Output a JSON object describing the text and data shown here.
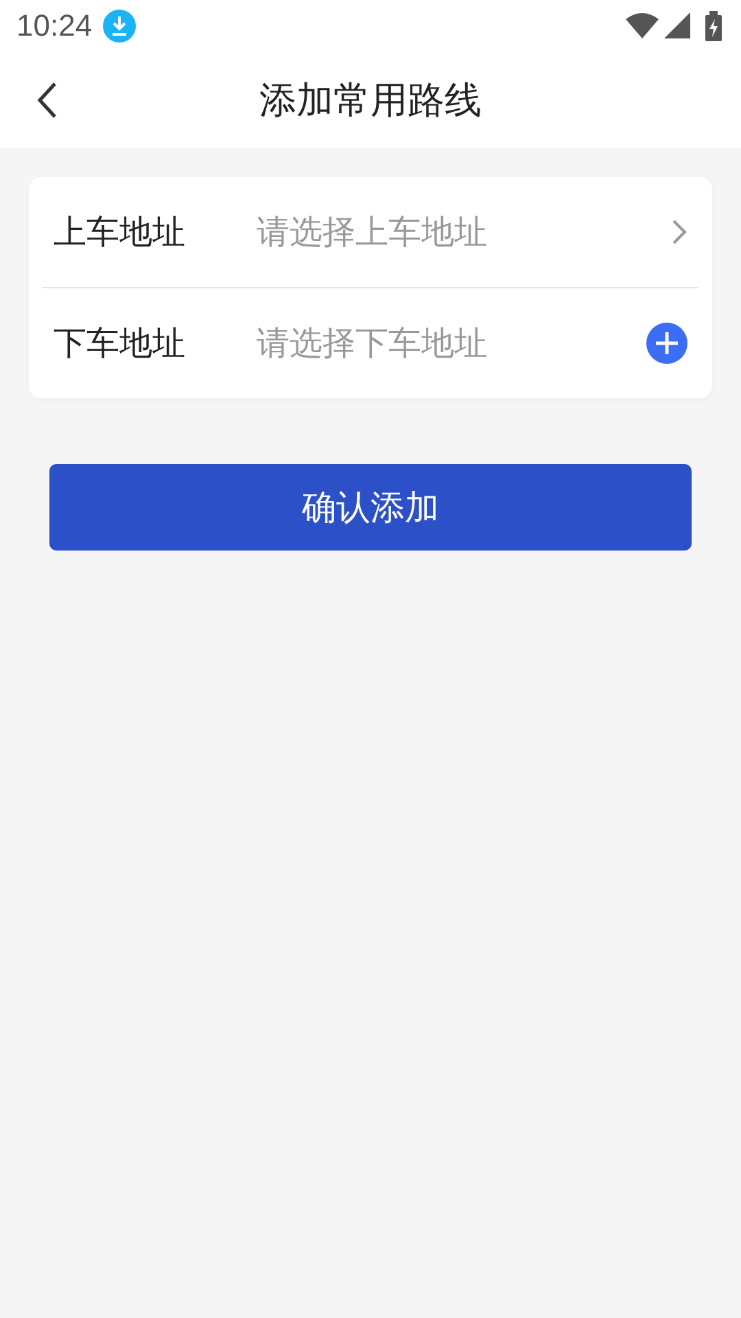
{
  "status_bar": {
    "time": "10:24"
  },
  "header": {
    "title": "添加常用路线"
  },
  "form": {
    "rows": [
      {
        "label": "上车地址",
        "placeholder": "请选择上车地址",
        "kind": "chevron"
      },
      {
        "label": "下车地址",
        "placeholder": "请选择下车地址",
        "kind": "add"
      }
    ]
  },
  "confirm_button": {
    "label": "确认添加"
  }
}
